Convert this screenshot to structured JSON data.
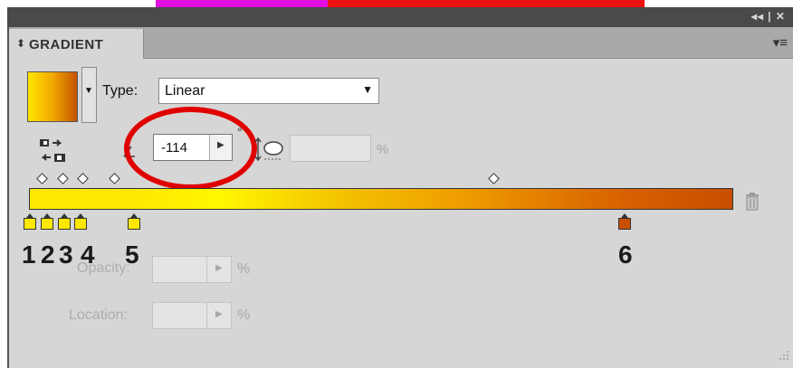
{
  "panel": {
    "tab_title": "GRADIENT",
    "tab_arrows": "⬍",
    "titlebar_controls": "◂◂ | ✕",
    "menu_icon": "▾≡"
  },
  "type": {
    "label": "Type:",
    "value": "Linear"
  },
  "angle": {
    "value": "-114",
    "degree": "°"
  },
  "aspect": {
    "percent": "%"
  },
  "stops": {
    "labels": [
      "1",
      "2",
      "3",
      "4",
      "5",
      "6"
    ],
    "colors": [
      "#ffe800",
      "#ffe800",
      "#ffe800",
      "#ffe800",
      "#ffe800",
      "#c84f00"
    ]
  },
  "opacity": {
    "label": "Opacity:",
    "percent": "%"
  },
  "location": {
    "label": "Location:",
    "percent": "%"
  },
  "colors": {
    "highlight_circle": "#e00000",
    "panel_bg": "#d6d6d6"
  }
}
